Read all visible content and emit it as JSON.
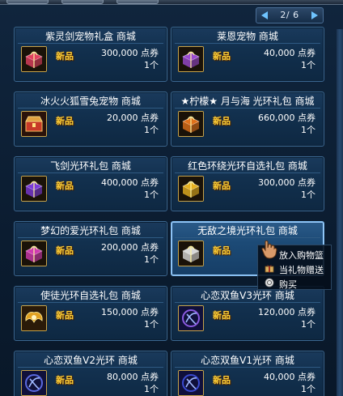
{
  "pager": {
    "text": "2/ 6"
  },
  "badge_new": "新品",
  "cards": [
    {
      "title": "紫灵剑宠物礼盒 商城",
      "price": "300,000 点券",
      "qty": "1个",
      "icon": "pink-gift-box-icon",
      "color": "#e04060"
    },
    {
      "title": "莱恩宠物 商城",
      "price": "40,000 点券",
      "qty": "1个",
      "icon": "purple-gift-box-icon",
      "color": "#9a4ad0"
    },
    {
      "title": "冰火火狐雪兔宠物 商城",
      "price": "20,000 点券",
      "qty": "1个",
      "icon": "red-treasure-chest-icon",
      "color": "#c83a28"
    },
    {
      "title": "★柠檬★ 月与海 光环礼包 商城",
      "price": "660,000 点券",
      "qty": "1个",
      "icon": "orange-gift-box-icon",
      "color": "#e0701a"
    },
    {
      "title": "飞剑光环礼包 商城",
      "price": "400,000 点券",
      "qty": "1个",
      "icon": "violet-gift-box-icon",
      "color": "#7a3ad8"
    },
    {
      "title": "红色环绕光环自选礼包 商城",
      "price": "300,000 点券",
      "qty": "1个",
      "icon": "gold-gift-box-icon",
      "color": "#e6b020"
    },
    {
      "title": "梦幻的爱光环礼包 商城",
      "price": "200,000 点券",
      "qty": "1个",
      "icon": "magenta-gift-box-icon",
      "color": "#d03ab0"
    },
    {
      "title": "无敌之境光环礼包 商城",
      "price": "",
      "qty": "",
      "icon": "white-gift-box-icon",
      "color": "#d8d8d8"
    },
    {
      "title": "使徒光环自选礼包 商城",
      "price": "150,000 点券",
      "qty": "1个",
      "icon": "golden-wings-icon",
      "color": "#e0a020"
    },
    {
      "title": "心恋双鱼V3光环 商城",
      "price": "120,000 点券",
      "qty": "1个",
      "icon": "purple-fish-aura-icon",
      "color": "#8a5ae0"
    },
    {
      "title": "心恋双鱼V2光环 商城",
      "price": "80,000 点券",
      "qty": "1个",
      "icon": "blue-fish-aura-icon",
      "color": "#5a6ae0"
    },
    {
      "title": "心恋双鱼V1光环 商城",
      "price": "40,000 点券",
      "qty": "1个",
      "icon": "navy-fish-aura-icon",
      "color": "#3a4ad0"
    }
  ],
  "context_menu": {
    "add_to_cart": "放入购物篮",
    "send_gift": "当礼物赠送",
    "buy": "购买"
  },
  "icons": {
    "cart": "basket-icon",
    "gift": "gift-icon",
    "buy": "coin-icon",
    "cursor": "hand-cursor-icon"
  }
}
